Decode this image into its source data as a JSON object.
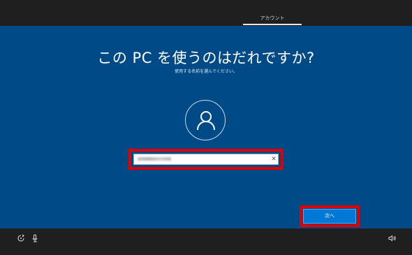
{
  "header": {
    "tab_account": "アカウント"
  },
  "main": {
    "title": "この PC を使うのはだれですか?",
    "subtitle": "使用する名前を選んでください。",
    "avatar_icon": "user-icon",
    "username_field": {
      "value": "",
      "placeholder": "",
      "clear_icon": "close-icon"
    },
    "next_button_label": "次へ"
  },
  "footer": {
    "icons": [
      "ease-of-access-icon",
      "microphone-icon",
      "volume-icon"
    ]
  },
  "colors": {
    "panel_blue": "#004a87",
    "button_blue": "#0078d7",
    "highlight_red": "#e00000",
    "bar_dark": "#1f1f1f"
  }
}
